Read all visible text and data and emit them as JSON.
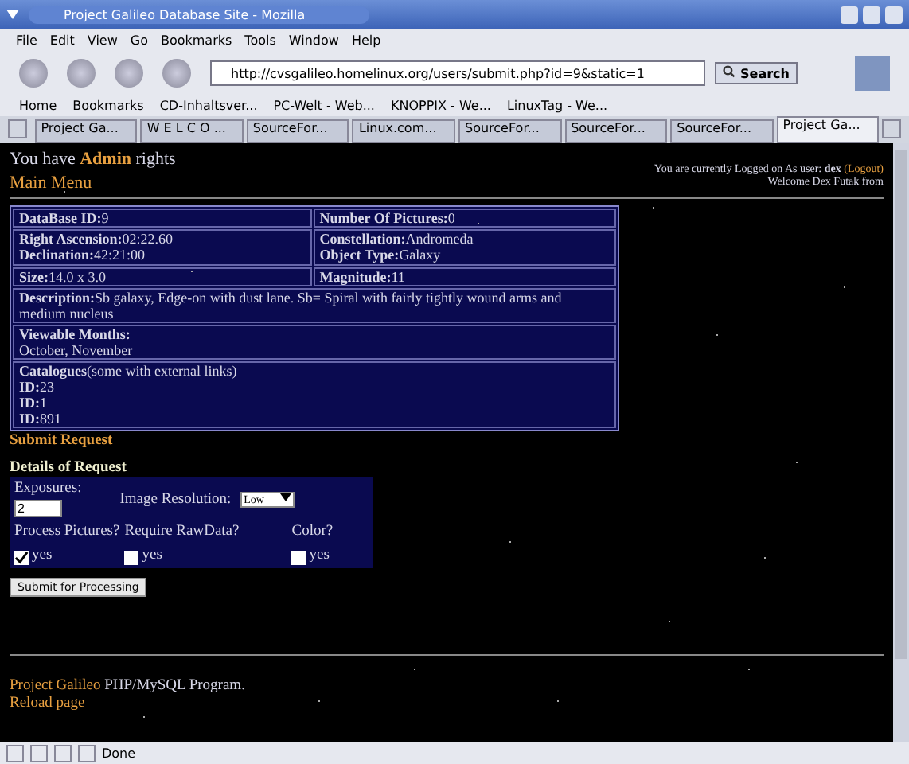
{
  "window": {
    "title": "Project Galileo Database Site - Mozilla"
  },
  "menu": [
    "File",
    "Edit",
    "View",
    "Go",
    "Bookmarks",
    "Tools",
    "Window",
    "Help"
  ],
  "address": {
    "url": "http://cvsgalileo.homelinux.org/users/submit.php?id=9&static=1",
    "search_button": "Search"
  },
  "bookmarks": [
    "Home",
    "Bookmarks",
    "CD-Inhaltsver...",
    "PC-Welt - Web...",
    "KNOPPIX - We...",
    "LinuxTag - We..."
  ],
  "tabs": [
    {
      "label": "Project Ga...",
      "selected": false
    },
    {
      "label": "W E L C O ...",
      "selected": false
    },
    {
      "label": "SourceFor...",
      "selected": false
    },
    {
      "label": "Linux.com...",
      "selected": false
    },
    {
      "label": "SourceFor...",
      "selected": false
    },
    {
      "label": "SourceFor...",
      "selected": false
    },
    {
      "label": "SourceFor...",
      "selected": false
    },
    {
      "label": "Project Ga...",
      "selected": true
    }
  ],
  "page": {
    "admin_notice": "You have **Admin** rights",
    "main_menu": "Main Menu",
    "login": {
      "prefix": "You are currently Logged on As user:",
      "user": "dex",
      "logout": "(Logout)",
      "welcome": "Welcome Dex Futak from"
    },
    "info_rows": [
      {
        "cells": [
          {
            "lines": [
              {
                "label": "DataBase ID:",
                "value": "9"
              }
            ]
          },
          {
            "lines": [
              {
                "label": "Number Of Pictures:",
                "value": "0"
              }
            ]
          }
        ]
      },
      {
        "cells": [
          {
            "lines": [
              {
                "label": "Right Ascension:",
                "value": "02:22.60"
              },
              {
                "label": "Declination:",
                "value": "42:21:00"
              }
            ]
          },
          {
            "lines": [
              {
                "label": "Constellation:",
                "value": "Andromeda"
              },
              {
                "label": "Object Type:",
                "value": "Galaxy"
              }
            ]
          }
        ]
      },
      {
        "cells": [
          {
            "lines": [
              {
                "label": "Size:",
                "value": "14.0 x 3.0"
              }
            ]
          },
          {
            "lines": [
              {
                "label": "Magnitude:",
                "value": "11"
              }
            ]
          }
        ]
      },
      {
        "cells": [
          {
            "lines": [
              {
                "label": "Description:",
                "value": "Sb galaxy, Edge-on with dust lane. Sb= Spiral with fairly tightly wound arms and medium nucleus"
              }
            ]
          }
        ]
      },
      {
        "cells": [
          {
            "lines": [
              {
                "label": "Viewable Months:"
              },
              {
                "value": "October, November"
              }
            ]
          }
        ]
      },
      {
        "cells": [
          {
            "lines": [
              {
                "label": "Catalogues",
                "value": "(some with external links)"
              },
              {
                "label": "ID:",
                "value": "23"
              },
              {
                "label": "ID:",
                "value": "1"
              },
              {
                "label": "ID:",
                "value": "891"
              }
            ]
          }
        ]
      }
    ],
    "submit_request": "Submit Request",
    "details_heading": "Details of Request",
    "form": {
      "exposures_label": "Exposures:",
      "exposures_value": "2",
      "resolution_label": "Image Resolution:",
      "resolution_value": "Low",
      "checkboxes": [
        {
          "label": "Process Pictures?",
          "option": "yes",
          "checked": true
        },
        {
          "label": "Require RawData?",
          "option": "yes",
          "checked": false
        },
        {
          "label": "Color?",
          "option": "yes",
          "checked": false
        }
      ],
      "submit_button": "Submit for Processing"
    },
    "footer": {
      "project": "Project Galileo",
      "text": "PHP/MySQL Program.",
      "reload": "Reload page"
    }
  },
  "status": "Done"
}
